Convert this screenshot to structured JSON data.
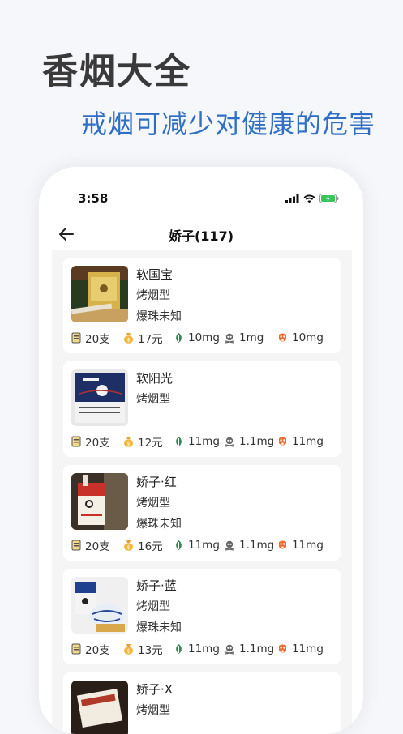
{
  "promo": {
    "title": "香烟大全",
    "subtitle": "戒烟可减少对健康的危害"
  },
  "status_bar": {
    "time": "3:58"
  },
  "nav": {
    "title": "娇子(117)"
  },
  "items": [
    {
      "name": "软国宝",
      "type": "烤烟型",
      "popbead": "爆珠未知",
      "count": "20支",
      "price": "17元",
      "tar": "10mg",
      "nicotine": "1mg",
      "co": "10mg"
    },
    {
      "name": "软阳光",
      "type": "烤烟型",
      "popbead": "",
      "count": "20支",
      "price": "12元",
      "tar": "11mg",
      "nicotine": "1.1mg",
      "co": "11mg"
    },
    {
      "name": "娇子·红",
      "type": "烤烟型",
      "popbead": "爆珠未知",
      "count": "20支",
      "price": "16元",
      "tar": "11mg",
      "nicotine": "1.1mg",
      "co": "11mg"
    },
    {
      "name": "娇子·蓝",
      "type": "烤烟型",
      "popbead": "爆珠未知",
      "count": "20支",
      "price": "13元",
      "tar": "11mg",
      "nicotine": "1.1mg",
      "co": "11mg"
    },
    {
      "name": "娇子·X",
      "type": "烤烟型",
      "popbead": "",
      "count": "",
      "price": "",
      "tar": "",
      "nicotine": "",
      "co": ""
    }
  ],
  "colors": {
    "accent_blue": "#2f6fc6",
    "title_gray": "#3a3a3a",
    "battery_green": "#34c759"
  }
}
